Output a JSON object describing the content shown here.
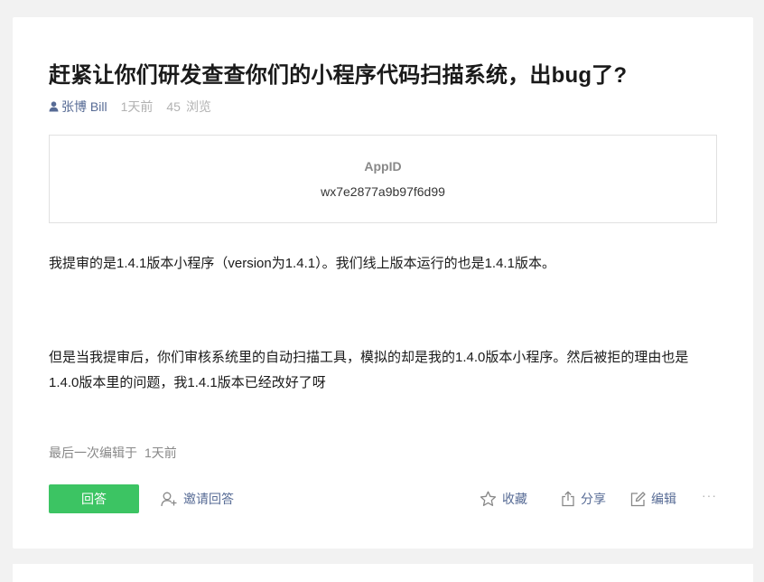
{
  "post": {
    "title": "赶紧让你们研发查查你们的小程序代码扫描系统，出bug了?",
    "author": "张博 Bill",
    "time": "1天前",
    "views_count": "45",
    "views_label": "浏览"
  },
  "appid_box": {
    "label": "AppID",
    "value": "wx7e2877a9b97f6d99"
  },
  "body": {
    "paragraph1": "我提审的是1.4.1版本小程序（version为1.4.1）。我们线上版本运行的也是1.4.1版本。",
    "paragraph2": "但是当我提审后，你们审核系统里的自动扫描工具，模拟的却是我的1.4.0版本小程序。然后被拒的理由也是1.4.0版本里的问题，我1.4.1版本已经改好了呀"
  },
  "edit_info": {
    "label": "最后一次编辑于",
    "time": "1天前"
  },
  "actions": {
    "answer": "回答",
    "invite": "邀请回答",
    "favorite": "收藏",
    "share": "分享",
    "edit": "编辑",
    "more": "···"
  },
  "colors": {
    "primary_green": "#3cc463",
    "link_blue": "#576b95",
    "muted": "#b2b2b2"
  },
  "icons": [
    "user-icon",
    "invite-user-icon",
    "star-icon",
    "share-icon",
    "edit-icon"
  ]
}
